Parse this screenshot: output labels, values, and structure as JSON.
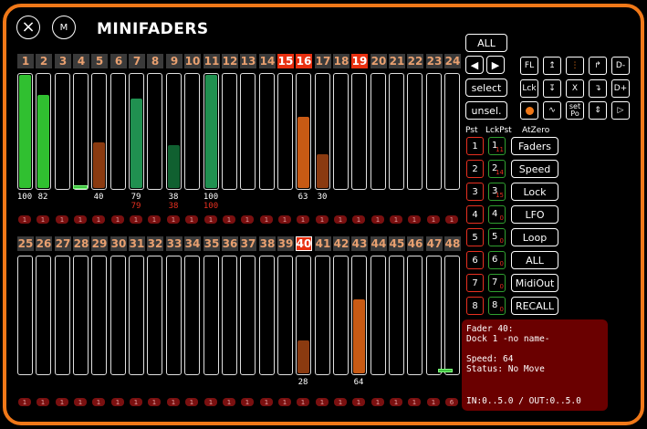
{
  "title": "MINIFADERS",
  "header": {
    "close_label": "×",
    "menu_label": "M"
  },
  "row1": {
    "numbers": [
      "1",
      "2",
      "3",
      "4",
      "5",
      "6",
      "7",
      "8",
      "9",
      "10",
      "11",
      "12",
      "13",
      "14",
      "15",
      "16",
      "17",
      "18",
      "19",
      "20",
      "21",
      "22",
      "23",
      "24"
    ],
    "active": [
      15,
      16,
      19
    ],
    "values": [
      100,
      82,
      0,
      0,
      40,
      0,
      79,
      0,
      38,
      0,
      100,
      0,
      0,
      0,
      0,
      63,
      30,
      0,
      0,
      0,
      0,
      0,
      0,
      0
    ],
    "labels": [
      "100",
      "82",
      "",
      "",
      "40",
      "",
      "79",
      "",
      "38",
      "",
      "100",
      "",
      "",
      "",
      "",
      "63",
      "30",
      "",
      "",
      "",
      "",
      "",
      "",
      ""
    ],
    "sub_labels": [
      "",
      "",
      "",
      "",
      "",
      "",
      "79",
      "",
      "38",
      "",
      "100",
      "",
      "",
      "",
      "",
      "",
      "",
      "",
      "",
      "",
      "",
      "",
      "",
      ""
    ],
    "colors": [
      "green",
      "green",
      "",
      "",
      "brown",
      "",
      "greenmid",
      "",
      "greendark",
      "",
      "greenmid",
      "",
      "",
      "",
      "",
      "orange",
      "brown",
      "",
      "",
      "",
      "",
      "",
      "",
      ""
    ],
    "pills": [
      "1",
      "1",
      "1",
      "1",
      "1",
      "1",
      "1",
      "1",
      "1",
      "1",
      "1",
      "1",
      "1",
      "1",
      "1",
      "1",
      "1",
      "1",
      "1",
      "1",
      "1",
      "1",
      "1",
      "1"
    ]
  },
  "row2": {
    "numbers": [
      "25",
      "26",
      "27",
      "28",
      "29",
      "30",
      "31",
      "32",
      "33",
      "34",
      "35",
      "36",
      "37",
      "38",
      "39",
      "40",
      "41",
      "42",
      "43",
      "44",
      "45",
      "46",
      "47",
      "48"
    ],
    "selected": [
      40
    ],
    "values": [
      0,
      0,
      0,
      0,
      0,
      0,
      0,
      0,
      0,
      0,
      0,
      0,
      0,
      0,
      0,
      28,
      0,
      0,
      64,
      0,
      0,
      0,
      0,
      0
    ],
    "labels": [
      "",
      "",
      "",
      "",
      "",
      "",
      "",
      "",
      "",
      "",
      "",
      "",
      "",
      "",
      "",
      "28",
      "",
      "",
      "64",
      "",
      "",
      "",
      "",
      ""
    ],
    "colors": [
      "",
      "",
      "",
      "",
      "",
      "",
      "",
      "",
      "",
      "",
      "",
      "",
      "",
      "",
      "",
      "brown",
      "",
      "",
      "orange",
      "",
      "",
      "",
      "",
      ""
    ],
    "pills": [
      "1",
      "1",
      "1",
      "1",
      "1",
      "1",
      "1",
      "1",
      "1",
      "1",
      "1",
      "1",
      "1",
      "1",
      "1",
      "1",
      "1",
      "1",
      "1",
      "1",
      "1",
      "1",
      "1",
      "6"
    ]
  },
  "side": {
    "all_label": "ALL",
    "select_label": "select",
    "unsel_label": "unsel.",
    "fl_label": "FL",
    "lck_label": "Lck",
    "x_label": "X",
    "dminus_label": "D-",
    "dplus_label": "D+",
    "setpo_label": "set Po",
    "col_headers": [
      "Pst",
      "LckPst",
      "AtZero"
    ],
    "presets": [
      "1",
      "2",
      "3",
      "4",
      "5",
      "6",
      "7",
      "8"
    ],
    "lock_presets": [
      {
        "n": "1",
        "s": "11"
      },
      {
        "n": "2",
        "s": "14"
      },
      {
        "n": "3",
        "s": "15"
      },
      {
        "n": "4",
        "s": "0"
      },
      {
        "n": "5",
        "s": "0"
      },
      {
        "n": "6",
        "s": "0"
      },
      {
        "n": "7",
        "s": "0"
      },
      {
        "n": "8",
        "s": "0"
      }
    ],
    "actions": [
      "Faders",
      "Speed",
      "Lock",
      "LFO",
      "Loop",
      "ALL",
      "MidiOut",
      "RECALL"
    ]
  },
  "info": {
    "line1": "Fader 40:",
    "line2": "Dock 1 -no name-",
    "line3": "Speed: 64",
    "line4": "Status: No Move",
    "io": "IN:0..5.0 / OUT:0..5.0"
  },
  "colors": {
    "accent": "#f07818",
    "green": "#30c030",
    "brown": "#8a3a10",
    "orange": "#c85a14",
    "red": "#e83010"
  }
}
